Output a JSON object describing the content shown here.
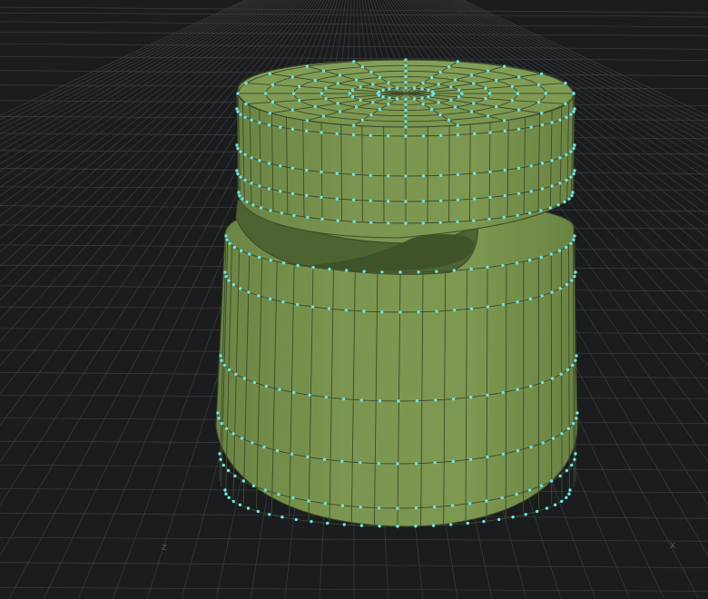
{
  "viewport": {
    "background_color": "#1b1c1e",
    "grid_color": "#3a3c40",
    "mesh_color": "#7a944f",
    "mesh_shadow_color": "#4d6331",
    "edge_color": "#3d4a2a",
    "point_color": "#6fe3e6",
    "axis_labels": {
      "z": "z",
      "x": "x"
    }
  }
}
